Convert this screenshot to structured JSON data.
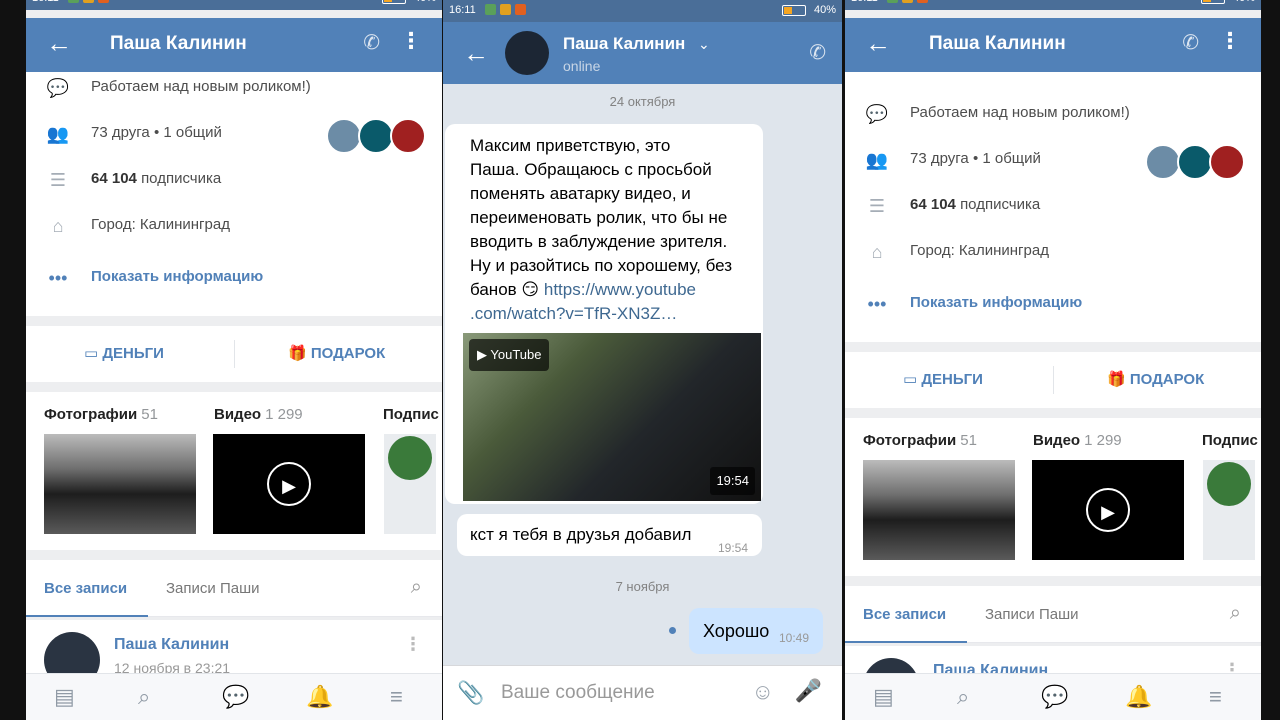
{
  "status": {
    "time": "16:11",
    "battery": "40%"
  },
  "profile": {
    "name": "Паша Калинин",
    "status_text": "Работаем над новым роликом!)",
    "friends_count": "73 друга",
    "friends_common": "• 1 общий",
    "followers_count": "64 104",
    "followers_label": "подписчика",
    "city": "Город: Калининград",
    "show_info": "Показать информацию",
    "money_btn": "ДЕНЬГИ",
    "gift_btn": "ПОДАРОК",
    "photos_label": "Фотографии",
    "photos_count": "51",
    "videos_label": "Видео",
    "videos_count": "1 299",
    "subs_label": "Подпис",
    "tab_all": "Все записи",
    "tab_own": "Записи Паши",
    "post_author": "Паша Калинин",
    "post_date": "12 ноября в 23:21"
  },
  "chat": {
    "name": "Паша Калинин",
    "status": "online",
    "date1": "24 октября",
    "msg1_lines": [
      "Максим приветствую, это",
      "Паша. Обращаюсь с просьбой",
      "поменять аватарку видео, и",
      "переименовать ролик, что бы не",
      "вводить в заблуждение зрителя.",
      "Ну и разойтись по хорошему, без"
    ],
    "msg1_last": "банов 😏",
    "msg1_link1": "https://www.youtube",
    "msg1_link2": ".com/watch?v=TfR-XN3Z…",
    "yt_label": "YouTube",
    "yt_duration": "19:54",
    "msg2": "кст я тебя в друзья добавил",
    "msg2_time": "19:54",
    "date2": "7 ноября",
    "msg3": "Хорошо",
    "msg3_time": "10:49",
    "input_placeholder": "Ваше сообщение"
  }
}
